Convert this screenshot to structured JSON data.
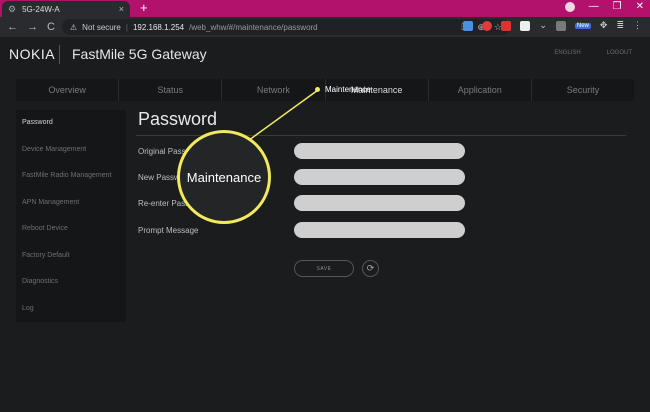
{
  "browser": {
    "tab_title": "5G-24W-A",
    "tab_close": "×",
    "new_tab": "+",
    "security": "Not secure",
    "host": "192.168.1.254",
    "path": "/web_whw/#/maintenance/password",
    "new_badge": "New",
    "nav_back": "←",
    "nav_forward": "→",
    "nav_reload": "C",
    "window_min": "—",
    "window_max": "❐",
    "window_close": "✕"
  },
  "header": {
    "brand": "NOKIA",
    "product": "FastMile 5G Gateway",
    "language": "ENGLISH",
    "logout": "LOGOUT"
  },
  "nav": {
    "items": [
      "Overview",
      "Status",
      "Network",
      "Maintenance",
      "Application",
      "Security"
    ],
    "active": "Maintenance"
  },
  "sidebar": {
    "items": [
      {
        "label": "Password",
        "active": true
      },
      {
        "label": "Device Management",
        "active": false
      },
      {
        "label": "FastMile Radio Management",
        "active": false
      },
      {
        "label": "APN Management",
        "active": false
      },
      {
        "label": "Reboot Device",
        "active": false
      },
      {
        "label": "Factory Default",
        "active": false
      },
      {
        "label": "Diagnostics",
        "active": false
      },
      {
        "label": "Log",
        "active": false
      }
    ]
  },
  "page": {
    "title": "Password",
    "fields": [
      {
        "label": "Original Passw",
        "value": ""
      },
      {
        "label": "New Passw",
        "value": ""
      },
      {
        "label": "Re-enter Pass",
        "value": ""
      },
      {
        "label": "Prompt Message",
        "value": ""
      }
    ],
    "save_label": "SAVE",
    "refresh_icon": "⟳"
  },
  "callout": {
    "label": "Maintenance",
    "magnified_text": "Maintenance",
    "color": "#f1ea5c"
  }
}
